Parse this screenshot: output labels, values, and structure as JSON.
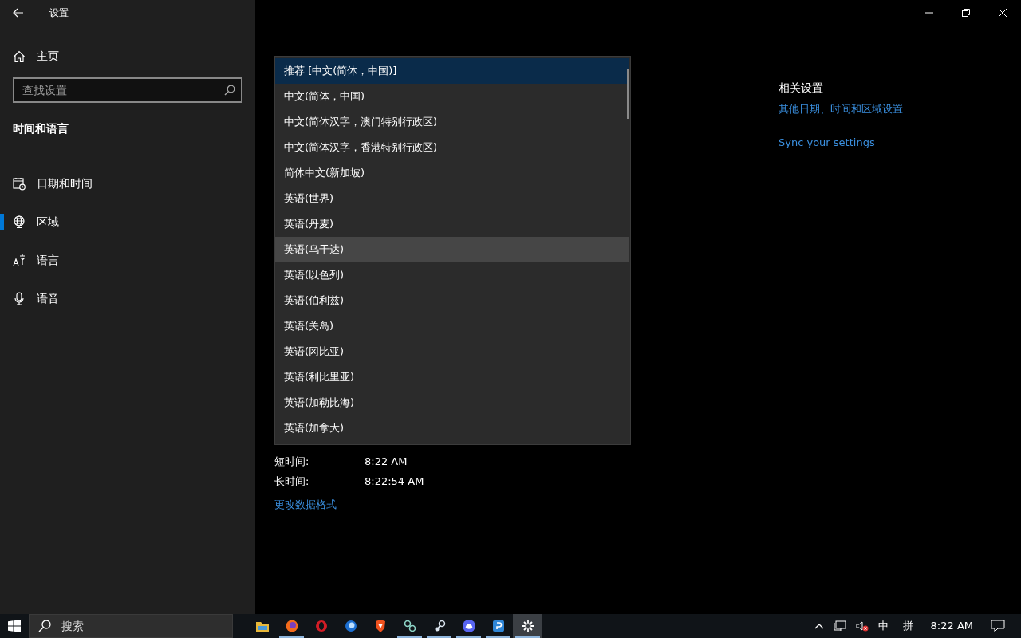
{
  "window": {
    "title": "设置"
  },
  "sidebar": {
    "home": "主页",
    "search": {
      "placeholder": "查找设置"
    },
    "section": "时间和语言",
    "items": [
      {
        "label": "日期和时间",
        "selected": false
      },
      {
        "label": "区域",
        "selected": true
      },
      {
        "label": "语言",
        "selected": false
      },
      {
        "label": "语音",
        "selected": false
      }
    ]
  },
  "formats": [
    {
      "label": "短时间:",
      "value": "8:22 AM"
    },
    {
      "label": "长时间:",
      "value": "8:22:54 AM"
    }
  ],
  "change_formats_link": "更改数据格式",
  "related": {
    "title": "相关设置",
    "links": [
      "其他日期、时间和区域设置",
      "Sync your settings"
    ]
  },
  "dropdown": {
    "options": [
      {
        "label": "推荐 [中文(简体，中国)]",
        "selected": true,
        "hovered": false
      },
      {
        "label": "中文(简体，中国)",
        "selected": false,
        "hovered": false
      },
      {
        "label": "中文(简体汉字，澳门特别行政区)",
        "selected": false,
        "hovered": false
      },
      {
        "label": "中文(简体汉字，香港特别行政区)",
        "selected": false,
        "hovered": false
      },
      {
        "label": "简体中文(新加坡)",
        "selected": false,
        "hovered": false
      },
      {
        "label": "英语(世界)",
        "selected": false,
        "hovered": false
      },
      {
        "label": "英语(丹麦)",
        "selected": false,
        "hovered": false
      },
      {
        "label": "英语(乌干达)",
        "selected": false,
        "hovered": true
      },
      {
        "label": "英语(以色列)",
        "selected": false,
        "hovered": false
      },
      {
        "label": "英语(伯利兹)",
        "selected": false,
        "hovered": false
      },
      {
        "label": "英语(关岛)",
        "selected": false,
        "hovered": false
      },
      {
        "label": "英语(冈比亚)",
        "selected": false,
        "hovered": false
      },
      {
        "label": "英语(利比里亚)",
        "selected": false,
        "hovered": false
      },
      {
        "label": "英语(加勒比海)",
        "selected": false,
        "hovered": false
      },
      {
        "label": "英语(加拿大)",
        "selected": false,
        "hovered": false
      }
    ]
  },
  "taskbar": {
    "search": {
      "placeholder": "搜索"
    },
    "apps": [
      {
        "active": false,
        "running": false
      },
      {
        "active": false,
        "running": true
      },
      {
        "active": false,
        "running": false
      },
      {
        "active": false,
        "running": false
      },
      {
        "active": false,
        "running": false
      },
      {
        "active": false,
        "running": true
      },
      {
        "active": false,
        "running": true
      },
      {
        "active": false,
        "running": true
      },
      {
        "active": false,
        "running": true
      },
      {
        "active": true,
        "running": true
      }
    ],
    "ime_mode": "中",
    "ime_name": "拼",
    "clock": "8:22 AM"
  }
}
